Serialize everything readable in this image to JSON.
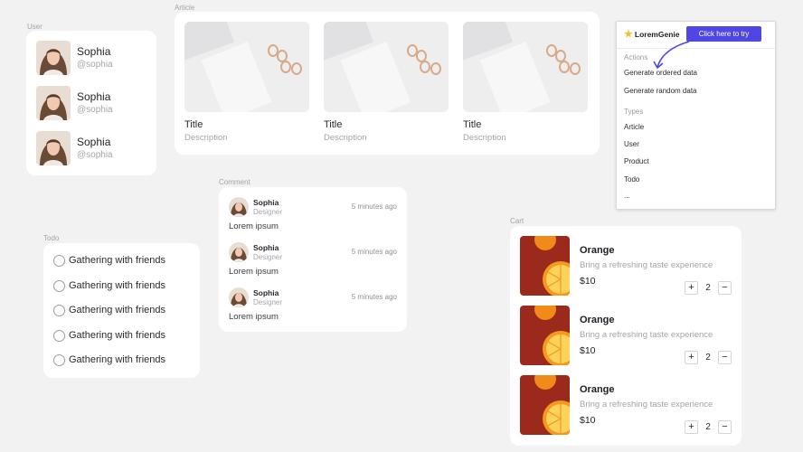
{
  "labels": {
    "user": "User",
    "article": "Article",
    "comment": "Comment",
    "todo": "Todo",
    "cart": "Cart"
  },
  "users": [
    {
      "name": "Sophia",
      "handle": "@sophia"
    },
    {
      "name": "Sophia",
      "handle": "@sophia"
    },
    {
      "name": "Sophia",
      "handle": "@sophia"
    }
  ],
  "articles": [
    {
      "title": "Title",
      "description": "Description"
    },
    {
      "title": "Title",
      "description": "Description"
    },
    {
      "title": "Title",
      "description": "Description"
    }
  ],
  "comments": [
    {
      "name": "Sophia",
      "role": "Designer",
      "time": "5 minutes ago",
      "text": "Lorem ipsum"
    },
    {
      "name": "Sophia",
      "role": "Designer",
      "time": "5 minutes ago",
      "text": "Lorem ipsum"
    },
    {
      "name": "Sophia",
      "role": "Designer",
      "time": "5 minutes ago",
      "text": "Lorem ipsum"
    }
  ],
  "todos": [
    {
      "label": "Gathering with friends"
    },
    {
      "label": "Gathering with friends"
    },
    {
      "label": "Gathering with friends"
    },
    {
      "label": "Gathering with friends"
    },
    {
      "label": "Gathering with friends"
    }
  ],
  "popup": {
    "brand": "LoremGenie",
    "cta": "Click here to try",
    "actions_heading": "Actions",
    "actions": [
      "Generate ordered data",
      "Generate random data"
    ],
    "types_heading": "Types",
    "types": [
      "Article",
      "User",
      "Product",
      "Todo",
      "..."
    ]
  },
  "cart": [
    {
      "name": "Orange",
      "description": "Bring a refreshing taste experience",
      "price": "$10",
      "quantity": "2"
    },
    {
      "name": "Orange",
      "description": "Bring a refreshing taste experience",
      "price": "$10",
      "quantity": "2"
    },
    {
      "name": "Orange",
      "description": "Bring a refreshing taste experience",
      "price": "$10",
      "quantity": "2"
    }
  ],
  "stepper": {
    "plus": "+",
    "minus": "−"
  },
  "colors": {
    "accent": "#4f46e5",
    "background": "#f2f2f3",
    "star": "#f2c230"
  }
}
